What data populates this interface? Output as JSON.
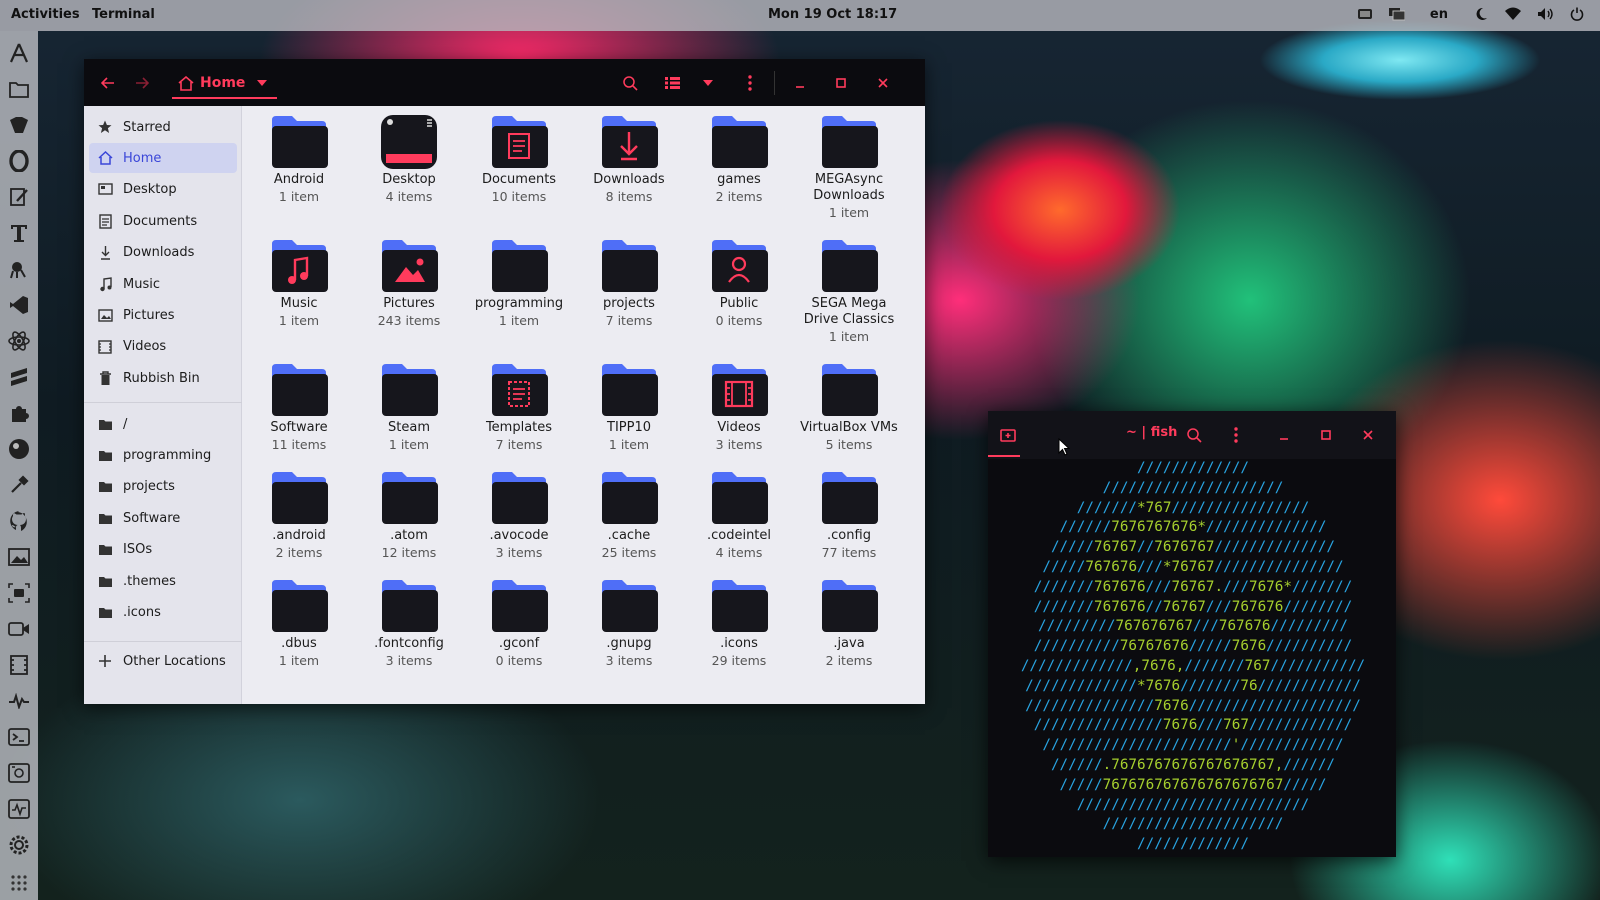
{
  "topbar": {
    "activities": "Activities",
    "app_name": "Terminal",
    "clock": "Mon 19 Oct  18:17",
    "language": "en",
    "tray_icons": [
      "screenshot-icon",
      "displays-icon",
      "night-mode-icon",
      "wifi-icon",
      "volume-icon",
      "power-icon"
    ]
  },
  "dock": {
    "icons": [
      "appstore-icon",
      "files-icon",
      "nautilus-icon",
      "opera-icon",
      "text-editor-icon",
      "typora-icon",
      "gitkraken-icon",
      "vscode-icon",
      "atom-icon",
      "sublime-icon",
      "extensions-icon",
      "obs-icon",
      "color-picker-icon",
      "github-icon",
      "image-viewer-icon",
      "screenshot-icon",
      "camera-icon",
      "video-icon",
      "monitor-icon",
      "terminal-icon",
      "virtualbox-icon",
      "system-monitor-icon",
      "settings-icon",
      "app-grid-icon"
    ]
  },
  "filemanager": {
    "location": "Home",
    "sidebar": {
      "places": [
        {
          "label": "Starred",
          "icon": "star-icon"
        },
        {
          "label": "Home",
          "icon": "home-icon",
          "active": true
        },
        {
          "label": "Desktop",
          "icon": "desktop-icon"
        },
        {
          "label": "Documents",
          "icon": "document-icon"
        },
        {
          "label": "Downloads",
          "icon": "download-icon"
        },
        {
          "label": "Music",
          "icon": "music-icon"
        },
        {
          "label": "Pictures",
          "icon": "picture-icon"
        },
        {
          "label": "Videos",
          "icon": "video-icon"
        },
        {
          "label": "Rubbish Bin",
          "icon": "trash-icon"
        }
      ],
      "bookmarks": [
        {
          "label": "/"
        },
        {
          "label": "programming"
        },
        {
          "label": "projects"
        },
        {
          "label": "Software"
        },
        {
          "label": "ISOs"
        },
        {
          "label": ".themes"
        },
        {
          "label": ".icons"
        }
      ],
      "other": "Other Locations"
    },
    "items": [
      {
        "name": "Android",
        "count": "1 item",
        "kind": "folder"
      },
      {
        "name": "Desktop",
        "count": "4 items",
        "kind": "desktop"
      },
      {
        "name": "Documents",
        "count": "10 items",
        "kind": "documents"
      },
      {
        "name": "Downloads",
        "count": "8 items",
        "kind": "downloads"
      },
      {
        "name": "games",
        "count": "2 items",
        "kind": "folder"
      },
      {
        "name": "MEGAsync Downloads",
        "name_l1": "MEGAsync",
        "name_l2": "Downloads",
        "count": "1 item",
        "kind": "folder"
      },
      {
        "name": "Music",
        "count": "1 item",
        "kind": "music"
      },
      {
        "name": "Pictures",
        "count": "243 items",
        "kind": "pictures"
      },
      {
        "name": "programming",
        "count": "1 item",
        "kind": "folder"
      },
      {
        "name": "projects",
        "count": "7 items",
        "kind": "folder"
      },
      {
        "name": "Public",
        "count": "0 items",
        "kind": "public"
      },
      {
        "name": "SEGA Mega Drive Classics",
        "name_l1": "SEGA Mega",
        "name_l2": "Drive Classics",
        "count": "1 item",
        "kind": "folder"
      },
      {
        "name": "Software",
        "count": "11 items",
        "kind": "folder"
      },
      {
        "name": "Steam",
        "count": "1 item",
        "kind": "folder"
      },
      {
        "name": "Templates",
        "count": "7 items",
        "kind": "templates"
      },
      {
        "name": "TIPP10",
        "count": "1 item",
        "kind": "folder"
      },
      {
        "name": "Videos",
        "count": "3 items",
        "kind": "videos"
      },
      {
        "name": "VirtualBox VMs",
        "count": "5 items",
        "kind": "folder"
      },
      {
        "name": ".android",
        "count": "2 items",
        "kind": "folder"
      },
      {
        "name": ".atom",
        "count": "12 items",
        "kind": "folder"
      },
      {
        "name": ".avocode",
        "count": "3 items",
        "kind": "folder"
      },
      {
        "name": ".cache",
        "count": "25 items",
        "kind": "folder"
      },
      {
        "name": ".codeintel",
        "count": "4 items",
        "kind": "folder"
      },
      {
        "name": ".config",
        "count": "77 items",
        "kind": "folder"
      },
      {
        "name": ".dbus",
        "count": "1 item",
        "kind": "folder"
      },
      {
        "name": ".fontconfig",
        "count": "3 items",
        "kind": "folder"
      },
      {
        "name": ".gconf",
        "count": "0 items",
        "kind": "folder"
      },
      {
        "name": ".gnupg",
        "count": "3 items",
        "kind": "folder"
      },
      {
        "name": ".icons",
        "count": "29 items",
        "kind": "folder"
      },
      {
        "name": ".java",
        "count": "2 items",
        "kind": "folder"
      }
    ]
  },
  "terminal": {
    "title": "~ | fish",
    "lines": [
      "/////////////",
      "/////////////////////",
      "///////*767////////////////",
      "//////7676767676*//////////////",
      "/////76767//7676767//////////////",
      "/////767676///*76767///////////////",
      "///////767676///76767.///7676*///////",
      "///////767676//76767///767676////////",
      "/////////767676767///767676/////////",
      "//////////76767676/////7676//////////",
      "/////////////,7676,///////767///////////",
      "/////////////*7676///////76////////////",
      "///////////////7676////////////////////",
      "///////////////7676///767////////////",
      "//////////////////////'////////////",
      "//////.7676767676767676767,//////",
      "/////767676767676767676767/////",
      "///////////////////////////",
      "/////////////////////",
      "/////////////"
    ]
  },
  "colors": {
    "accent": "#ff3b5c",
    "folder_blue": "#4f6ef7",
    "folder_dark": "#16161c",
    "selection": "#cfd3f0",
    "terminal_blue": "#29a3e0",
    "terminal_green": "#a6cf2e"
  }
}
